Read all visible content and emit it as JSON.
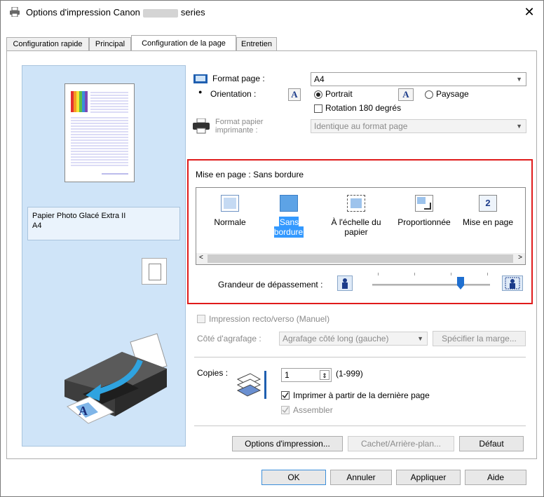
{
  "window": {
    "title_prefix": "Options d'impression Canon",
    "title_suffix": "series",
    "close": "✕"
  },
  "tabs": [
    "Configuration rapide",
    "Principal",
    "Configuration de la page",
    "Entretien"
  ],
  "preview": {
    "media": "Papier Photo Glacé Extra II",
    "size": "A4"
  },
  "page_format": {
    "label": "Format page :",
    "value": "A4"
  },
  "orientation": {
    "label": "Orientation :",
    "portrait": "Portrait",
    "landscape": "Paysage",
    "rotate": "Rotation 180 degrés",
    "selected": "Portrait"
  },
  "printer_paper": {
    "label1": "Format papier",
    "label2": "imprimante :",
    "value": "Identique au format page"
  },
  "layout": {
    "label": "Mise en page :",
    "current": "Sans bordure",
    "items": [
      {
        "label": "Normale"
      },
      {
        "label": "Sans bordure"
      },
      {
        "label": "À l'échelle du",
        "label2": "papier"
      },
      {
        "label": "Proportionnée"
      },
      {
        "label": "Mise en page"
      }
    ],
    "selected_index": 1,
    "extension_label": "Grandeur de dépassement :",
    "extension_level": 0.75
  },
  "duplex": {
    "label": "Impression recto/verso (Manuel)"
  },
  "stapling": {
    "label": "Côté d'agrafage :",
    "value": "Agrafage côté long (gauche)",
    "margin_button": "Spécifier la marge..."
  },
  "copies": {
    "label": "Copies :",
    "value": "1",
    "range": "(1-999)",
    "last_page": "Imprimer à partir de la dernière page",
    "collate": "Assembler"
  },
  "buttons": {
    "options": "Options d'impression...",
    "stamp": "Cachet/Arrière-plan...",
    "default": "Défaut"
  },
  "footer": {
    "ok": "OK",
    "cancel": "Annuler",
    "apply": "Appliquer",
    "help": "Aide"
  },
  "colors": {
    "accent": "#3399ff",
    "highlight_red": "#e01b1b",
    "preview_bg": "#cfe4f8"
  }
}
